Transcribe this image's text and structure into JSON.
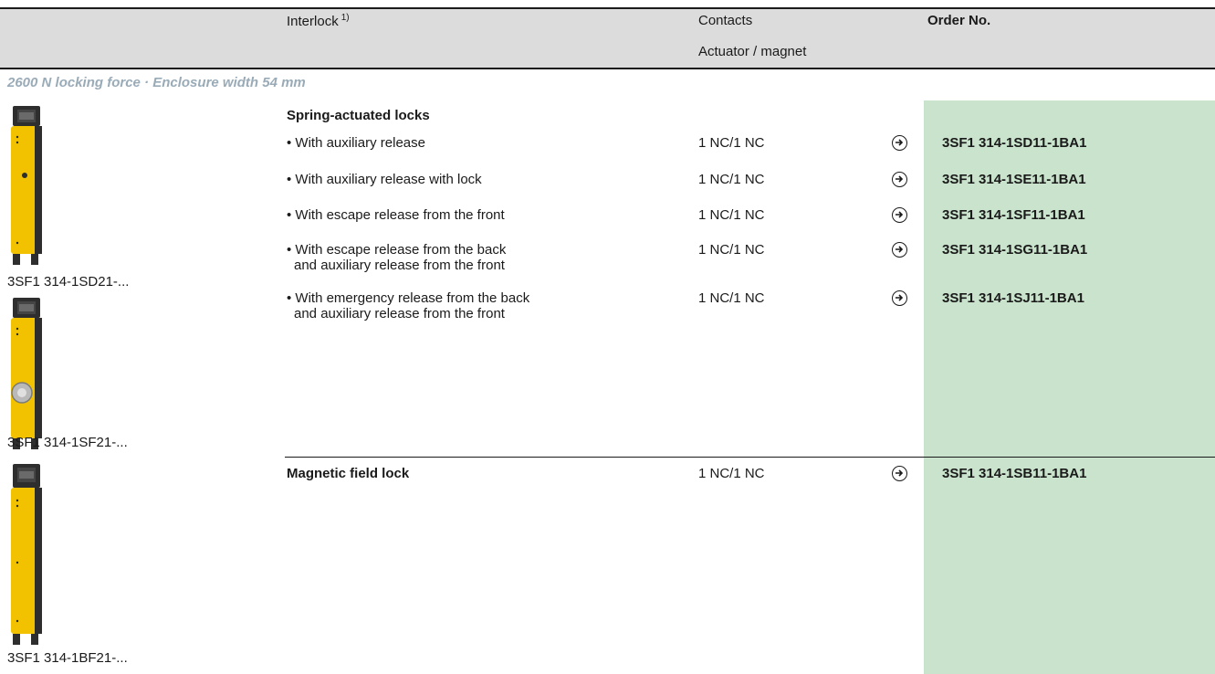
{
  "header": {
    "interlock_label": "Interlock",
    "interlock_footnote": "1)",
    "contacts_label": "Contacts",
    "actuator_label": "Actuator / magnet",
    "order_label": "Order No."
  },
  "section_title": "2600 N locking force · Enclosure width 54 mm",
  "groups": [
    {
      "title": "Spring-actuated locks",
      "rows": [
        {
          "desc": [
            "• With auxiliary release"
          ],
          "contacts": "1 NC/1 NC",
          "order_no": "3SF1 314-1SD11-1BA1"
        },
        {
          "desc": [
            "• With auxiliary release with lock"
          ],
          "contacts": "1 NC/1 NC",
          "order_no": "3SF1 314-1SE11-1BA1"
        },
        {
          "desc": [
            "• With escape release from the front"
          ],
          "contacts": "1 NC/1 NC",
          "order_no": "3SF1 314-1SF11-1BA1"
        },
        {
          "desc": [
            "• With escape release from the back",
            "and auxiliary release from the front"
          ],
          "contacts": "1 NC/1 NC",
          "order_no": "3SF1 314-1SG11-1BA1"
        },
        {
          "desc": [
            "• With emergency release from the back",
            "and auxiliary release from the front"
          ],
          "contacts": "1 NC/1 NC",
          "order_no": "3SF1 314-1SJ11-1BA1"
        }
      ]
    },
    {
      "title": "Magnetic field lock",
      "rows": [
        {
          "contacts": "1 NC/1 NC",
          "order_no": "3SF1 314-1SB11-1BA1"
        }
      ]
    }
  ],
  "images": [
    {
      "caption": "3SF1 314-1SD21-..."
    },
    {
      "caption": "3SF1 314-1SF21-..."
    },
    {
      "caption": "3SF1 314-1BF21-..."
    }
  ],
  "colors": {
    "order_panel": "#c9e3cc",
    "header_bg": "#dcdcdc",
    "section_title": "#9aabb8",
    "device_yellow": "#f2c200",
    "device_dark": "#2e2e2e"
  },
  "icons": {
    "order_indicator": "arrow-right-circle-icon"
  }
}
